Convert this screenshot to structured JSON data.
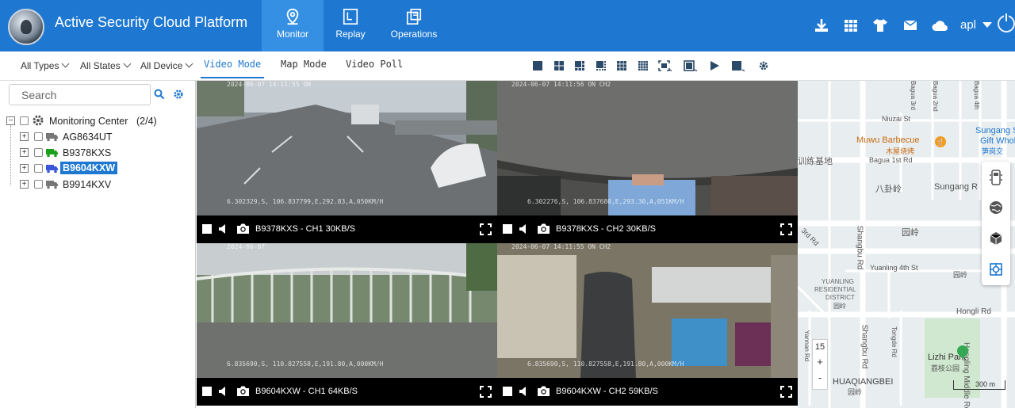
{
  "app": {
    "title": "Active Security Cloud Platform",
    "user": "apl"
  },
  "nav": {
    "tabs": [
      {
        "label": "Monitor",
        "icon": "location-pin-icon",
        "active": true
      },
      {
        "label": "Replay",
        "icon": "replay-icon",
        "active": false
      },
      {
        "label": "Operations",
        "icon": "operations-icon",
        "active": false
      }
    ]
  },
  "header_icons": [
    "download-icon",
    "grid-icon",
    "shirt-icon",
    "mail-icon",
    "cloud-icon",
    "power-icon"
  ],
  "filters": {
    "types": "All Types",
    "states": "All States",
    "device": "All Device"
  },
  "modes": {
    "video": "Video Mode",
    "map": "Map Mode",
    "poll": "Video Poll",
    "active": "Video Mode"
  },
  "toolbar_icons": [
    "layout-1-icon",
    "layout-4-icon",
    "layout-6-icon",
    "layout-8-icon",
    "layout-9-icon",
    "layout-16-icon",
    "fullscreen-icon",
    "window-icon",
    "play-icon",
    "stop-icon",
    "settings-icon"
  ],
  "search": {
    "placeholder": "Search"
  },
  "tree": {
    "root": {
      "label": "Monitoring Center",
      "count": "(2/4)"
    },
    "vehicles": [
      {
        "label": "AG8634UT",
        "status_color": "#777777",
        "selected": false
      },
      {
        "label": "B9378KXS",
        "status_color": "#1aa01a",
        "selected": false
      },
      {
        "label": "B9604KXW",
        "status_color": "#3a55d8",
        "selected": true
      },
      {
        "label": "B9914KXV",
        "status_color": "#777777",
        "selected": false
      }
    ]
  },
  "videos": [
    {
      "label": "B9378KXS - CH1 30KB/S",
      "timestamp": "2024-06-07 14:11:55 ON",
      "gps": "6.302329,S,  106.837799,E,292.83,A,050KM/H"
    },
    {
      "label": "B9378KXS - CH2 30KB/S",
      "timestamp": "2024-06-07 14:11:56 ON  CH2",
      "gps": "6.302276,S,  106.837680,E,293.30,A,051KM/H"
    },
    {
      "label": "B9604KXW - CH1 64KB/S",
      "timestamp": "2024-06-07",
      "gps": "6.835690,S,  110.827558,E,191.80,A,000KM/H"
    },
    {
      "label": "B9604KXW - CH2 59KB/S",
      "timestamp": "2024-06-07 14:11:55 ON  CH2",
      "gps": "6.835690,S,  110.827558,E,191.80,A,000KM/H"
    }
  ],
  "map": {
    "labels": {
      "niuzai": "Niuzai St",
      "muwu": "Muwu Barbecue",
      "muwu_cn": "木屋烧烤",
      "sungang_st": "Sungang St",
      "gift": "Gift Whole",
      "gift_cn": "笋岗交",
      "bagua1": "Bagua 1st Rd",
      "xunlian": "训练基地",
      "bagualing": "八卦岭",
      "sungang_rd": "Sungang R",
      "third": "3rd Rd",
      "yuanling1": "园岭",
      "shangbu": "Shangbu Rd",
      "yuanling4": "Yuanling 4th St",
      "yuanling2": "园岭",
      "district1": "YUANLING",
      "district2": "RESIDENTIAL",
      "district3": "DISTRICT",
      "yuanling3": "园岭",
      "hongli": "Hongli Rd",
      "honglin": "Hongling Middle Rd",
      "yannan": "Yannan Rd",
      "tongde": "Tongde Rd",
      "shangbu2": "Shangbu Rd",
      "lizhi": "Lizhi Park",
      "lizhi_cn": "荔枝公园",
      "huaqiang": "HUAQIANGBEI",
      "huaqiang_cn": "园岭",
      "baguasi": "Bagua 4th",
      "baguasan": "Bagua 3rd",
      "baguaer": "Bagua 2nd"
    },
    "zoom_level": "15",
    "zoom_in": "+",
    "zoom_out": "-",
    "scale": "300 m",
    "tool_icons": [
      "vehicle-icon",
      "globe-icon",
      "cube-icon",
      "locate-icon"
    ]
  }
}
